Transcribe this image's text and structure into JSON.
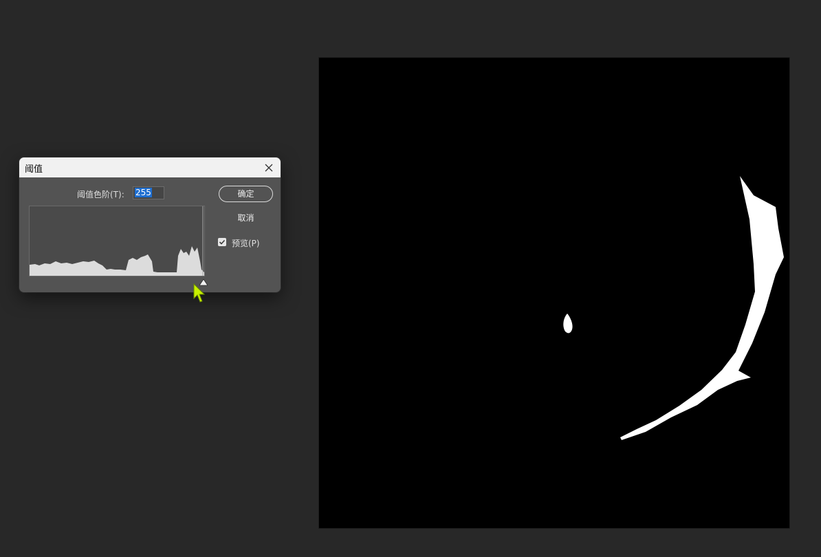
{
  "dialog": {
    "title": "阈值",
    "level_label": "阈值色阶(T):",
    "level_value": "255",
    "ok_label": "确定",
    "cancel_label": "取消",
    "preview_label": "预览(P)",
    "preview_checked": true,
    "icons": {
      "close": "close-icon",
      "check": "checkmark-icon",
      "slider": "triangle-slider-icon"
    }
  },
  "colors": {
    "workspace": "#282828",
    "dialog_body": "#535353",
    "titlebar": "#f1f1f1",
    "canvas": "#000000",
    "shape": "#ffffff",
    "cursor": "#c8f000",
    "selection": "#1f6fd1"
  }
}
